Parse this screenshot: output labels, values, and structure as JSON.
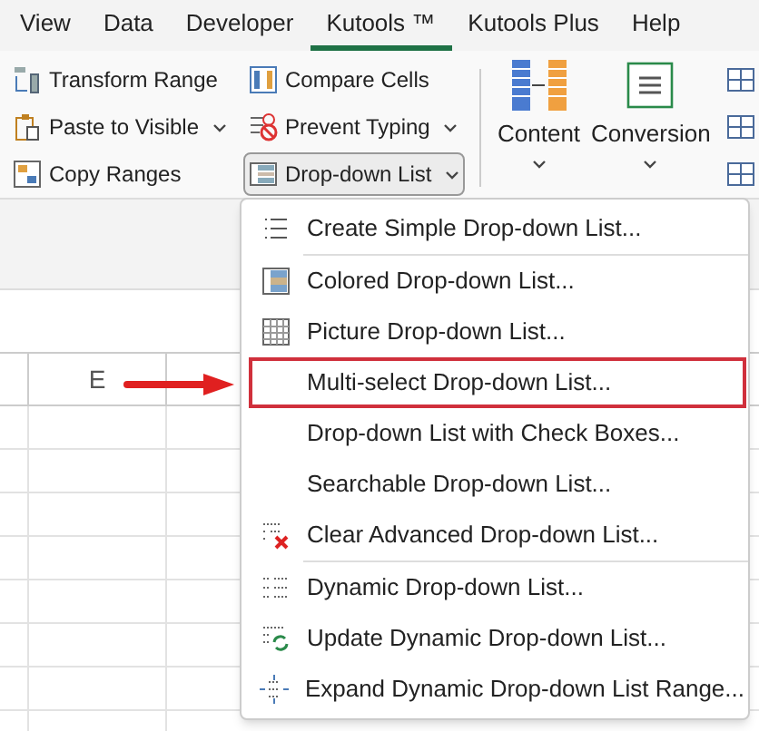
{
  "tabs": [
    {
      "label": "View",
      "selected": false
    },
    {
      "label": "Data",
      "selected": false
    },
    {
      "label": "Developer",
      "selected": false
    },
    {
      "label": "Kutools ™",
      "selected": true
    },
    {
      "label": "Kutools Plus",
      "selected": false
    },
    {
      "label": "Help",
      "selected": false
    }
  ],
  "ribbon": {
    "columns": [
      [
        {
          "label": "Transform Range",
          "dropdown": false,
          "pressed": false
        },
        {
          "label": "Paste to Visible",
          "dropdown": true,
          "pressed": false
        },
        {
          "label": "Copy Ranges",
          "dropdown": false,
          "pressed": false
        }
      ],
      [
        {
          "label": "Compare Cells",
          "dropdown": false,
          "pressed": false
        },
        {
          "label": "Prevent Typing",
          "dropdown": true,
          "pressed": false
        },
        {
          "label": "Drop-down List",
          "dropdown": true,
          "pressed": true
        }
      ]
    ],
    "large_buttons": [
      {
        "label": "Content"
      },
      {
        "label": "Conversion"
      }
    ]
  },
  "sheet": {
    "columns": [
      "E"
    ]
  },
  "menu": {
    "groups": [
      [
        {
          "label": "Create Simple Drop-down List...",
          "selected": false
        }
      ],
      [
        {
          "label": "Colored Drop-down List...",
          "selected": false
        },
        {
          "label": "Picture Drop-down List...",
          "selected": false
        },
        {
          "label": "Multi-select Drop-down List...",
          "selected": true
        },
        {
          "label": "Drop-down List with Check Boxes...",
          "selected": false
        },
        {
          "label": "Searchable Drop-down List...",
          "selected": false
        },
        {
          "label": "Clear Advanced Drop-down List...",
          "selected": false
        }
      ],
      [
        {
          "label": "Dynamic Drop-down List...",
          "selected": false
        },
        {
          "label": "Update Dynamic Drop-down List...",
          "selected": false
        },
        {
          "label": "Expand Dynamic Drop-down List Range...",
          "selected": false
        }
      ]
    ]
  }
}
